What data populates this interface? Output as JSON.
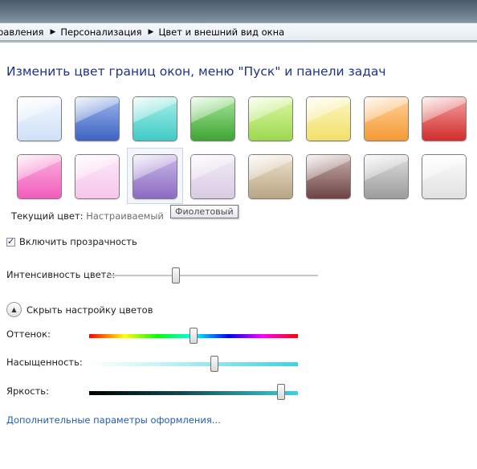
{
  "breadcrumb": {
    "items": [
      "равления",
      "Персонализация",
      "Цвет и внешний вид окна"
    ]
  },
  "heading": "Изменить цвет границ окон, меню \"Пуск\" и панели задач",
  "swatches": [
    {
      "name": "sky",
      "top": "#f4f8fe",
      "bottom": "#cfe0f7"
    },
    {
      "name": "twilight",
      "top": "#9db6e9",
      "bottom": "#3d63c4"
    },
    {
      "name": "sea",
      "top": "#a8efe9",
      "bottom": "#3fcbc6"
    },
    {
      "name": "leaf",
      "top": "#a7e59b",
      "bottom": "#3ea433"
    },
    {
      "name": "lime",
      "top": "#dcf7a4",
      "bottom": "#9cd94f"
    },
    {
      "name": "lemon",
      "top": "#fdf7c2",
      "bottom": "#f2df6a"
    },
    {
      "name": "pumpkin",
      "top": "#ffd29a",
      "bottom": "#f59a34"
    },
    {
      "name": "ruby",
      "top": "#f3a0a0",
      "bottom": "#d22c2c"
    },
    {
      "name": "fuchsia",
      "top": "#fcb1de",
      "bottom": "#f15cbb"
    },
    {
      "name": "blush",
      "top": "#fde9f8",
      "bottom": "#f6c6ec"
    },
    {
      "name": "violet",
      "top": "#c9b9e6",
      "bottom": "#8c6ac3"
    },
    {
      "name": "lavender",
      "top": "#f1ebf5",
      "bottom": "#d9cbe4"
    },
    {
      "name": "taupe",
      "top": "#ede2cf",
      "bottom": "#b8a684"
    },
    {
      "name": "chocolate",
      "top": "#c8b0ae",
      "bottom": "#6d4443"
    },
    {
      "name": "slate",
      "top": "#dcdcdc",
      "bottom": "#9c9c9c"
    },
    {
      "name": "frost",
      "top": "#fcfcfc",
      "bottom": "#e1e1e1"
    }
  ],
  "tooltip": "Фиолетовый",
  "current_color": {
    "label": "Текущий цвет:",
    "value": "Настраиваемый"
  },
  "transparency": {
    "label": "Включить прозрачность",
    "checked": true,
    "mark": "✓"
  },
  "intensity": {
    "label": "Интенсивность цвета:",
    "level": 0.32
  },
  "toggle": {
    "label": "Скрыть настройку цветов",
    "icon": "chevron-up-icon",
    "glyph": "▲"
  },
  "hue": {
    "label": "Оттенок:",
    "level": 0.5
  },
  "saturation": {
    "label": "Насыщенность:",
    "level": 0.6
  },
  "brightness": {
    "label": "Яркость:",
    "level": 0.92
  },
  "advanced_link": "Дополнительные параметры оформления..."
}
